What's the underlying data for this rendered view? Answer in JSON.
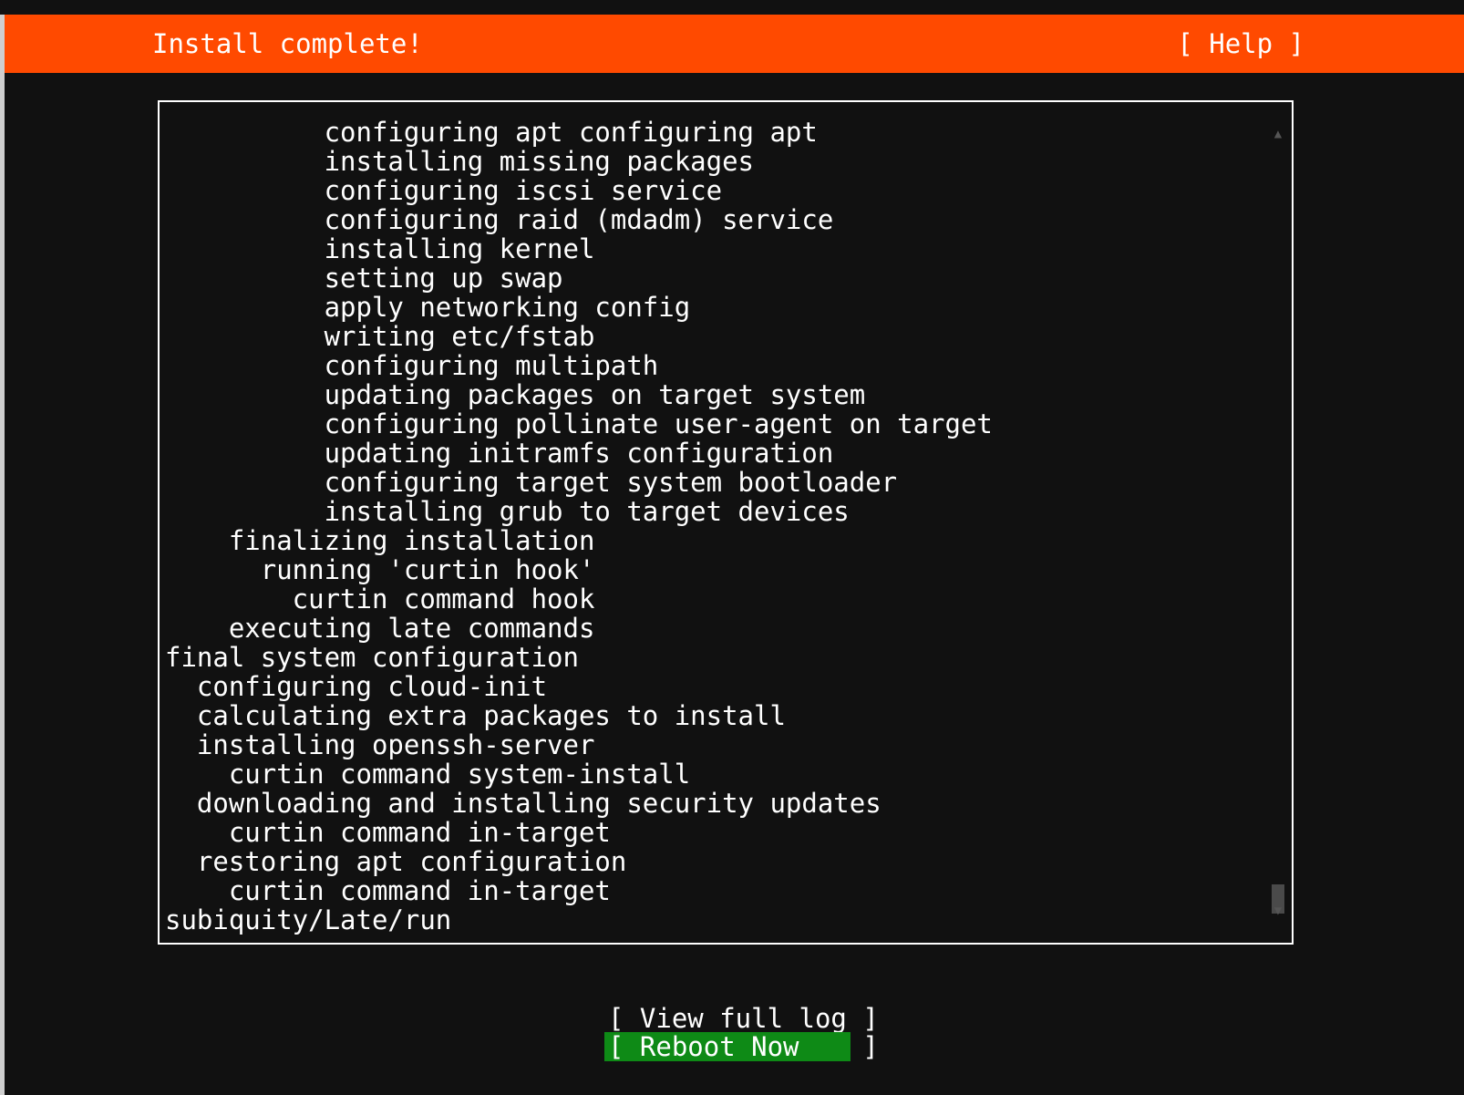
{
  "header": {
    "title": "Install complete!",
    "help_label": "[ Help ]",
    "background_color": "#ff4a00"
  },
  "log": {
    "lines": [
      "          configuring apt configuring apt",
      "          installing missing packages",
      "          configuring iscsi service",
      "          configuring raid (mdadm) service",
      "          installing kernel",
      "          setting up swap",
      "          apply networking config",
      "          writing etc/fstab",
      "          configuring multipath",
      "          updating packages on target system",
      "          configuring pollinate user-agent on target",
      "          updating initramfs configuration",
      "          configuring target system bootloader",
      "          installing grub to target devices",
      "    finalizing installation",
      "      running 'curtin hook'",
      "        curtin command hook",
      "    executing late commands",
      "final system configuration",
      "  configuring cloud-init",
      "  calculating extra packages to install",
      "  installing openssh-server",
      "    curtin command system-install",
      "  downloading and installing security updates",
      "    curtin command in-target",
      "  restoring apt configuration",
      "    curtin command in-target",
      "subiquity/Late/run"
    ],
    "scroll_up_icon": "triangle-up",
    "scroll_down_icon": "triangle-down"
  },
  "actions": {
    "view_log_label": "[ View full log ]",
    "reboot_label": "[ Reboot Now    ]",
    "reboot_color": "#0e8a16"
  }
}
